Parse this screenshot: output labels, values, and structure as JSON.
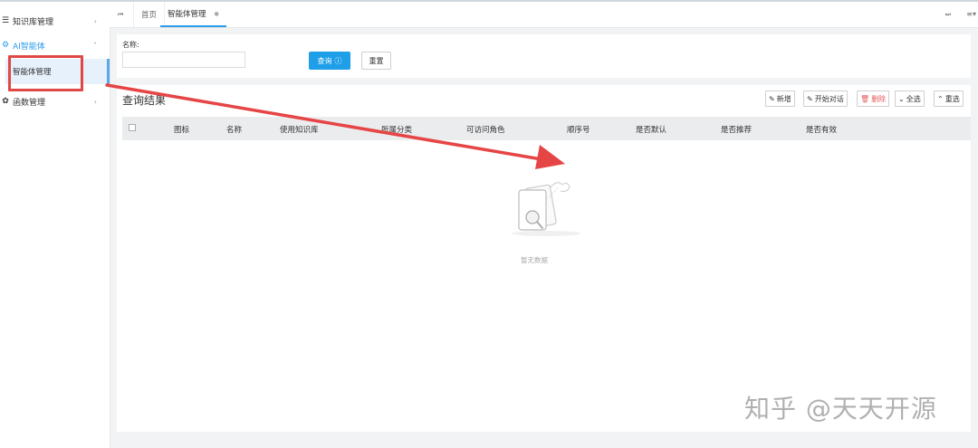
{
  "sidebar": {
    "items": [
      {
        "label": "知识库管理",
        "icon": "list-icon",
        "arrow": "›"
      },
      {
        "label": "AI智能体",
        "icon": "robot-icon",
        "arrow": "˅",
        "expanded": true
      },
      {
        "label": "智能体管理",
        "active": true
      },
      {
        "label": "函数管理",
        "icon": "gear-icon",
        "arrow": "›"
      }
    ]
  },
  "tabs": {
    "first_btn": "⏮",
    "home": "首页",
    "active": "智能体管理",
    "close": "●",
    "last_btn": "⏭",
    "menu_btn": "≡▾"
  },
  "search": {
    "name_label": "名称:",
    "name_value": "",
    "query_btn": "查询",
    "query_icon": "ⓘ",
    "reset_btn": "重置"
  },
  "results": {
    "title": "查询结果",
    "toolbar": {
      "add": "新增",
      "chat": "开始对话",
      "delete": "删除",
      "select_all": "全选",
      "invert": "重选"
    },
    "columns": [
      "图标",
      "名称",
      "使用知识库",
      "所属分类",
      "可访问角色",
      "顺序号",
      "是否默认",
      "是否推荐",
      "是否有效"
    ],
    "rows": [],
    "empty_text": "暂无数据"
  },
  "colors": {
    "accent": "#1e9fe8",
    "annotation": "#e04848",
    "delete": "#e45a5a"
  },
  "watermark": "知乎 @天天开源"
}
